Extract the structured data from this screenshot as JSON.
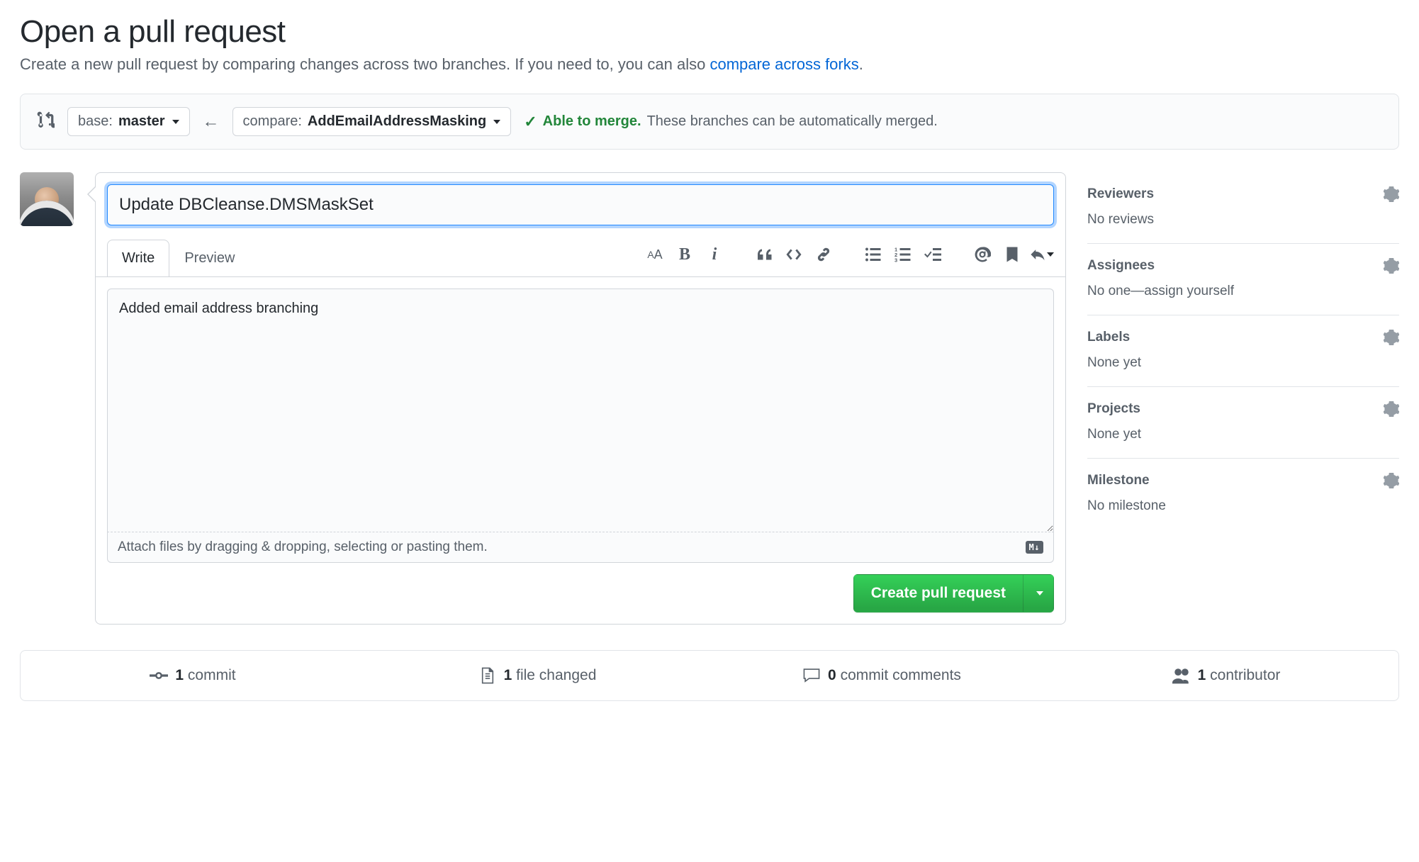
{
  "header": {
    "title": "Open a pull request",
    "subtitle_prefix": "Create a new pull request by comparing changes across two branches. If you need to, you can also ",
    "subtitle_link": "compare across forks",
    "subtitle_suffix": "."
  },
  "branches": {
    "base_label": "base:",
    "base_value": "master",
    "compare_label": "compare:",
    "compare_value": "AddEmailAddressMasking",
    "merge_ok_label": "Able to merge.",
    "merge_ok_detail": "These branches can be automatically merged."
  },
  "editor": {
    "title_value": "Update DBCleanse.DMSMaskSet",
    "tab_write": "Write",
    "tab_preview": "Preview",
    "body_value": "Added email address branching",
    "attach_hint": "Attach files by dragging & dropping, selecting or pasting them.",
    "md_badge": "M↓",
    "submit_label": "Create pull request"
  },
  "sidebar": {
    "reviewers": {
      "title": "Reviewers",
      "value": "No reviews"
    },
    "assignees": {
      "title": "Assignees",
      "value_prefix": "No one—",
      "value_link": "assign yourself"
    },
    "labels": {
      "title": "Labels",
      "value": "None yet"
    },
    "projects": {
      "title": "Projects",
      "value": "None yet"
    },
    "milestone": {
      "title": "Milestone",
      "value": "No milestone"
    }
  },
  "stats": {
    "commits": {
      "count": "1",
      "label": "commit"
    },
    "files": {
      "count": "1",
      "label": "file changed"
    },
    "comments": {
      "count": "0",
      "label": "commit comments"
    },
    "contributors": {
      "count": "1",
      "label": "contributor"
    }
  }
}
